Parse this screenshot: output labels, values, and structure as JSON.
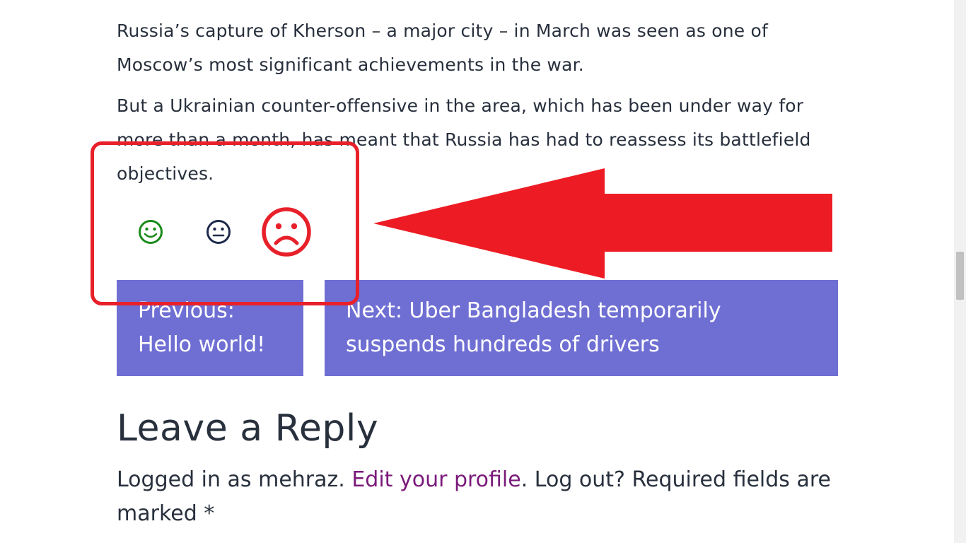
{
  "article": {
    "clipped_line": "...",
    "paragraph_1": "Russia’s capture of Kherson – a major city – in March was seen as one of Moscow’s most significant achievements in the war.",
    "paragraph_2": "But a Ukrainian counter-offensive in the area, which has been under way for more than a month, has meant that Russia has had to reassess its battlefield objectives."
  },
  "reactions": {
    "happy": {
      "glyph": "☺",
      "icon": "smiley-happy-icon",
      "color": "#1a8a1a"
    },
    "neutral": {
      "glyph": "😐",
      "icon": "smiley-neutral-icon",
      "color": "#1e2a4a"
    },
    "sad": {
      "icon": "smiley-sad-icon",
      "color": "#e8202a"
    }
  },
  "post_navigation": {
    "previous_prefix": "Previous:",
    "previous_title": "Hello world!",
    "next_prefix": "Next: Uber Bangladesh temporarily",
    "next_title": "suspends hundreds of drivers",
    "background": "#6f6fd3"
  },
  "comments": {
    "title": "Leave a Reply",
    "logged_in_prefix": "Logged in as mehraz. ",
    "edit_profile_link": "Edit your profile",
    "logged_in_suffix": ". Log out? Required fields are marked *"
  },
  "annotation": {
    "box_color": "#e8202a",
    "arrow_color": "#ed1c24"
  }
}
